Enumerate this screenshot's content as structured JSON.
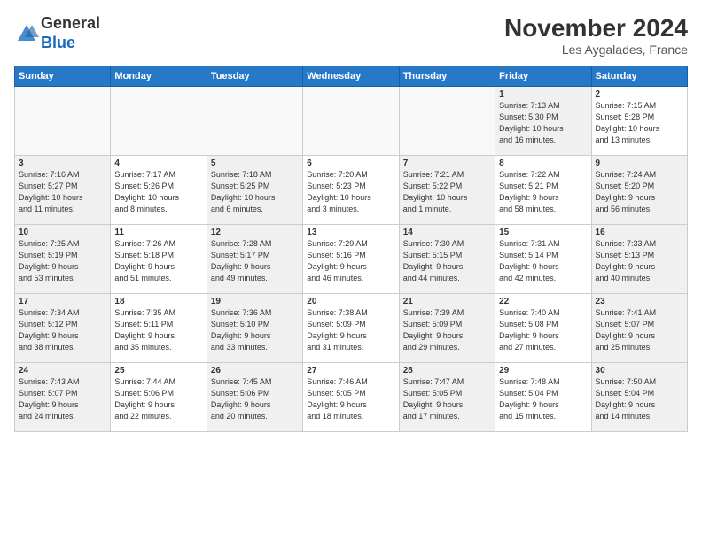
{
  "header": {
    "logo_general": "General",
    "logo_blue": "Blue",
    "month": "November 2024",
    "location": "Les Aygalades, France"
  },
  "days_of_week": [
    "Sunday",
    "Monday",
    "Tuesday",
    "Wednesday",
    "Thursday",
    "Friday",
    "Saturday"
  ],
  "weeks": [
    [
      {
        "day": "",
        "info": "",
        "empty": true
      },
      {
        "day": "",
        "info": "",
        "empty": true
      },
      {
        "day": "",
        "info": "",
        "empty": true
      },
      {
        "day": "",
        "info": "",
        "empty": true
      },
      {
        "day": "",
        "info": "",
        "empty": true
      },
      {
        "day": "1",
        "info": "Sunrise: 7:13 AM\nSunset: 5:30 PM\nDaylight: 10 hours\nand 16 minutes.",
        "shaded": true
      },
      {
        "day": "2",
        "info": "Sunrise: 7:15 AM\nSunset: 5:28 PM\nDaylight: 10 hours\nand 13 minutes."
      }
    ],
    [
      {
        "day": "3",
        "info": "Sunrise: 7:16 AM\nSunset: 5:27 PM\nDaylight: 10 hours\nand 11 minutes.",
        "shaded": true
      },
      {
        "day": "4",
        "info": "Sunrise: 7:17 AM\nSunset: 5:26 PM\nDaylight: 10 hours\nand 8 minutes."
      },
      {
        "day": "5",
        "info": "Sunrise: 7:18 AM\nSunset: 5:25 PM\nDaylight: 10 hours\nand 6 minutes.",
        "shaded": true
      },
      {
        "day": "6",
        "info": "Sunrise: 7:20 AM\nSunset: 5:23 PM\nDaylight: 10 hours\nand 3 minutes."
      },
      {
        "day": "7",
        "info": "Sunrise: 7:21 AM\nSunset: 5:22 PM\nDaylight: 10 hours\nand 1 minute.",
        "shaded": true
      },
      {
        "day": "8",
        "info": "Sunrise: 7:22 AM\nSunset: 5:21 PM\nDaylight: 9 hours\nand 58 minutes."
      },
      {
        "day": "9",
        "info": "Sunrise: 7:24 AM\nSunset: 5:20 PM\nDaylight: 9 hours\nand 56 minutes.",
        "shaded": true
      }
    ],
    [
      {
        "day": "10",
        "info": "Sunrise: 7:25 AM\nSunset: 5:19 PM\nDaylight: 9 hours\nand 53 minutes.",
        "shaded": true
      },
      {
        "day": "11",
        "info": "Sunrise: 7:26 AM\nSunset: 5:18 PM\nDaylight: 9 hours\nand 51 minutes."
      },
      {
        "day": "12",
        "info": "Sunrise: 7:28 AM\nSunset: 5:17 PM\nDaylight: 9 hours\nand 49 minutes.",
        "shaded": true
      },
      {
        "day": "13",
        "info": "Sunrise: 7:29 AM\nSunset: 5:16 PM\nDaylight: 9 hours\nand 46 minutes."
      },
      {
        "day": "14",
        "info": "Sunrise: 7:30 AM\nSunset: 5:15 PM\nDaylight: 9 hours\nand 44 minutes.",
        "shaded": true
      },
      {
        "day": "15",
        "info": "Sunrise: 7:31 AM\nSunset: 5:14 PM\nDaylight: 9 hours\nand 42 minutes."
      },
      {
        "day": "16",
        "info": "Sunrise: 7:33 AM\nSunset: 5:13 PM\nDaylight: 9 hours\nand 40 minutes.",
        "shaded": true
      }
    ],
    [
      {
        "day": "17",
        "info": "Sunrise: 7:34 AM\nSunset: 5:12 PM\nDaylight: 9 hours\nand 38 minutes.",
        "shaded": true
      },
      {
        "day": "18",
        "info": "Sunrise: 7:35 AM\nSunset: 5:11 PM\nDaylight: 9 hours\nand 35 minutes."
      },
      {
        "day": "19",
        "info": "Sunrise: 7:36 AM\nSunset: 5:10 PM\nDaylight: 9 hours\nand 33 minutes.",
        "shaded": true
      },
      {
        "day": "20",
        "info": "Sunrise: 7:38 AM\nSunset: 5:09 PM\nDaylight: 9 hours\nand 31 minutes."
      },
      {
        "day": "21",
        "info": "Sunrise: 7:39 AM\nSunset: 5:09 PM\nDaylight: 9 hours\nand 29 minutes.",
        "shaded": true
      },
      {
        "day": "22",
        "info": "Sunrise: 7:40 AM\nSunset: 5:08 PM\nDaylight: 9 hours\nand 27 minutes."
      },
      {
        "day": "23",
        "info": "Sunrise: 7:41 AM\nSunset: 5:07 PM\nDaylight: 9 hours\nand 25 minutes.",
        "shaded": true
      }
    ],
    [
      {
        "day": "24",
        "info": "Sunrise: 7:43 AM\nSunset: 5:07 PM\nDaylight: 9 hours\nand 24 minutes.",
        "shaded": true
      },
      {
        "day": "25",
        "info": "Sunrise: 7:44 AM\nSunset: 5:06 PM\nDaylight: 9 hours\nand 22 minutes."
      },
      {
        "day": "26",
        "info": "Sunrise: 7:45 AM\nSunset: 5:06 PM\nDaylight: 9 hours\nand 20 minutes.",
        "shaded": true
      },
      {
        "day": "27",
        "info": "Sunrise: 7:46 AM\nSunset: 5:05 PM\nDaylight: 9 hours\nand 18 minutes."
      },
      {
        "day": "28",
        "info": "Sunrise: 7:47 AM\nSunset: 5:05 PM\nDaylight: 9 hours\nand 17 minutes.",
        "shaded": true
      },
      {
        "day": "29",
        "info": "Sunrise: 7:48 AM\nSunset: 5:04 PM\nDaylight: 9 hours\nand 15 minutes."
      },
      {
        "day": "30",
        "info": "Sunrise: 7:50 AM\nSunset: 5:04 PM\nDaylight: 9 hours\nand 14 minutes.",
        "shaded": true
      }
    ]
  ]
}
